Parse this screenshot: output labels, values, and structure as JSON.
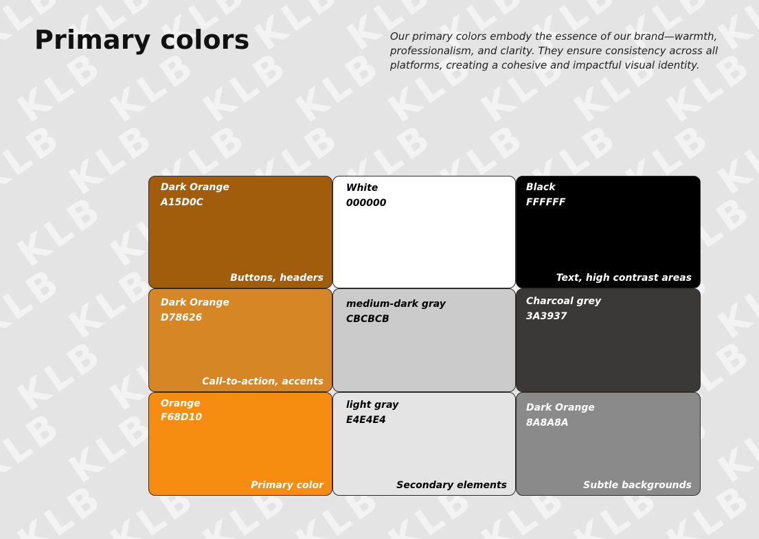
{
  "watermark": {
    "text": "KLB"
  },
  "header": {
    "title": "Primary colors",
    "description": "Our primary colors embody the essence of our brand—warmth, professionalism, and clarity. They ensure consistency across all platforms, creating a cohesive and impactful visual identity."
  },
  "swatches": [
    {
      "name": "Dark Orange",
      "hex": "A15D0C",
      "usage": "Buttons, headers",
      "fill": "#a15d0c",
      "text_color": "#ffffff"
    },
    {
      "name": "White",
      "hex": "000000",
      "usage": "",
      "fill": "#ffffff",
      "text_color": "#000000"
    },
    {
      "name": "Black",
      "hex": "FFFFFF",
      "usage": "Text, high contrast areas",
      "fill": "#000000",
      "text_color": "#ffffff"
    },
    {
      "name": "Dark Orange",
      "hex": "D78626",
      "usage": "Call-to-action, accents",
      "fill": "#d78626",
      "text_color": "#ffffff"
    },
    {
      "name": "medium-dark gray",
      "hex": "CBCBCB",
      "usage": "",
      "fill": "#cbcbcb",
      "text_color": "#000000"
    },
    {
      "name": "Charcoal grey",
      "hex": "3A3937",
      "usage": "",
      "fill": "#3a3937",
      "text_color": "#ffffff"
    },
    {
      "name": "Orange",
      "hex": "F68D10",
      "usage": "Primary color",
      "fill": "#f68d10",
      "text_color": "#ffffff"
    },
    {
      "name": "light gray",
      "hex": "E4E4E4",
      "usage": "Secondary elements",
      "fill": "#e4e4e4",
      "text_color": "#000000"
    },
    {
      "name": "Dark Orange",
      "hex": "8A8A8A",
      "usage": "Subtle backgrounds",
      "fill": "#8a8a8a",
      "text_color": "#ffffff"
    }
  ]
}
